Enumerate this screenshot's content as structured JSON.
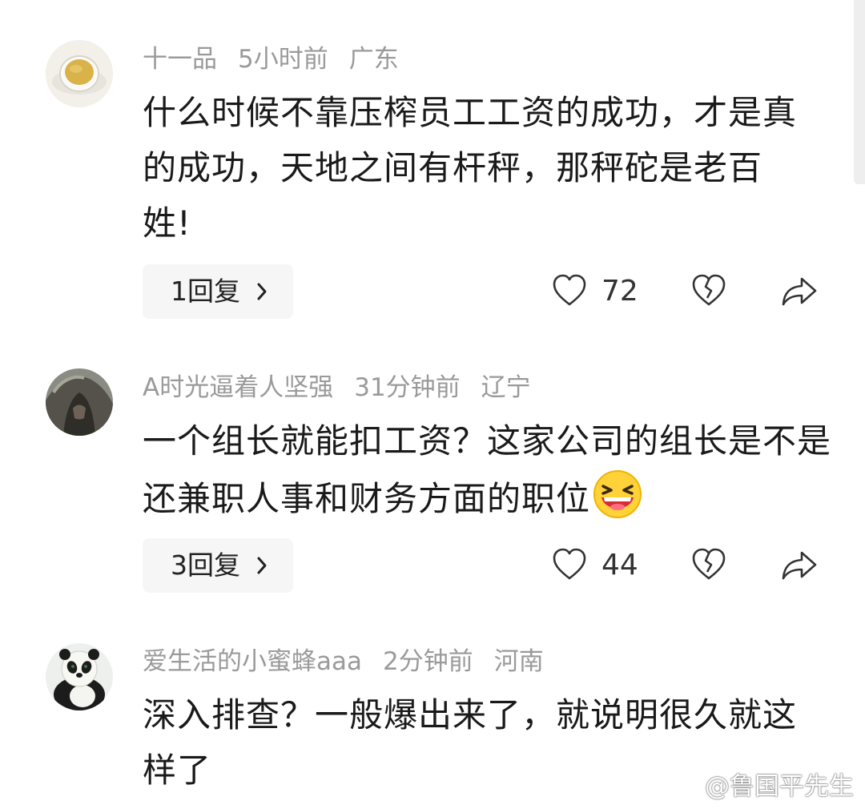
{
  "comments": [
    {
      "username": "十一品",
      "time": "5小时前",
      "location": "广东",
      "text": "什么时候不靠压榨员工工资的成功，才是真的成功，天地之间有杆秤，那秤砣是老百姓!",
      "replies_label": "1回复",
      "likes": "72"
    },
    {
      "username": "A时光逼着人坚强",
      "time": "31分钟前",
      "location": "辽宁",
      "text": "一个组长就能扣工资？这家公司的组长是不是还兼职人事和财务方面的职位",
      "replies_label": "3回复",
      "likes": "44"
    },
    {
      "username": "爱生活的小蜜蜂aaa",
      "time": "2分钟前",
      "location": "河南",
      "text": "深入排查？一般爆出来了，就说明很久就这样了"
    }
  ],
  "watermark": "@鲁国平先生",
  "icons": {
    "like": "heart-outline-icon",
    "dislike": "broken-heart-icon",
    "share": "share-arrow-icon",
    "reply_chevron": "chevron-right-icon",
    "weibo": "weibo-logo-icon"
  },
  "colors": {
    "text": "#1a1a1a",
    "meta": "#9a9a9a",
    "pill_bg": "#f6f6f6",
    "icon": "#333333"
  }
}
